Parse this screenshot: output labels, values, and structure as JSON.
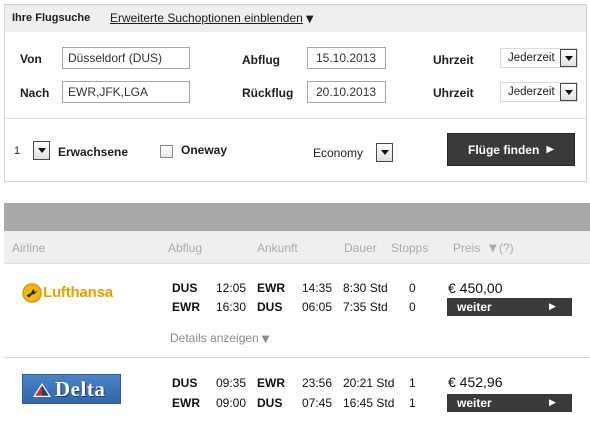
{
  "colors": {
    "panel_head_bg": "#efefef",
    "button_bg": "#3a3a3a",
    "button_text": "#ffffff",
    "results_bar": "#a9a9a9",
    "header_bg": "#efefef",
    "header_text": "#ababab",
    "lufthansa_yellow": "#e8a200",
    "delta_blue": "#4a83c9"
  },
  "icons": {
    "dropdown": "dropdown-arrow-icon",
    "checkbox": "checkbox-icon",
    "submit": "play-arrow-icon",
    "sort": "sort-down-icon",
    "help": "help-icon",
    "lufthansa": "lufthansa-crane-icon",
    "delta": "delta-widget-icon"
  },
  "search": {
    "title": "Ihre Flugsuche",
    "advanced_link": "Erweiterte Suchoptionen einblenden",
    "advanced_arrow": "▼",
    "from": {
      "label": "Von",
      "value": "Düsseldorf (DUS)"
    },
    "to": {
      "label": "Nach",
      "value": "EWR,JFK,LGA"
    },
    "depart_date": {
      "label": "Abflug",
      "value": "15.10.2013"
    },
    "return_date": {
      "label": "Rückflug",
      "value": "20.10.2013"
    },
    "depart_time": {
      "label": "Uhrzeit",
      "value": "Jederzeit"
    },
    "return_time": {
      "label": "Uhrzeit",
      "value": "Jederzeit"
    },
    "passengers": {
      "value": "1",
      "label": "Erwachsene"
    },
    "oneway": {
      "label": "Oneway",
      "checked": false
    },
    "cabin": {
      "value": "Economy"
    },
    "submit": {
      "label": "Flüge finden",
      "arrow": "▶"
    }
  },
  "results": {
    "columns": {
      "airline": "Airline",
      "depart": "Abflug",
      "arrive": "Ankunft",
      "duration": "Dauer",
      "stops": "Stopps",
      "price": "Preis",
      "price_sort": "▼",
      "price_help": "(?)"
    },
    "flights": [
      {
        "airline": "Lufthansa",
        "legs": [
          {
            "from": "DUS",
            "dep": "12:05",
            "to": "EWR",
            "arr": "14:35",
            "duration": "8:30 Std",
            "stops": "0"
          },
          {
            "from": "EWR",
            "dep": "16:30",
            "to": "DUS",
            "arr": "06:05",
            "duration": "7:35 Std",
            "stops": "0"
          }
        ],
        "price": "€ 450,00",
        "action": "weiter",
        "action_arrow": "▶",
        "details": "Details anzeigen",
        "details_arrow": "▼"
      },
      {
        "airline": "Delta",
        "legs": [
          {
            "from": "DUS",
            "dep": "09:35",
            "to": "EWR",
            "arr": "23:56",
            "duration": "20:21 Std",
            "stops": "1"
          },
          {
            "from": "EWR",
            "dep": "09:00",
            "to": "DUS",
            "arr": "07:45",
            "duration": "16:45 Std",
            "stops": "1"
          }
        ],
        "price": "€ 452,96",
        "action": "weiter",
        "action_arrow": "▶"
      }
    ]
  }
}
